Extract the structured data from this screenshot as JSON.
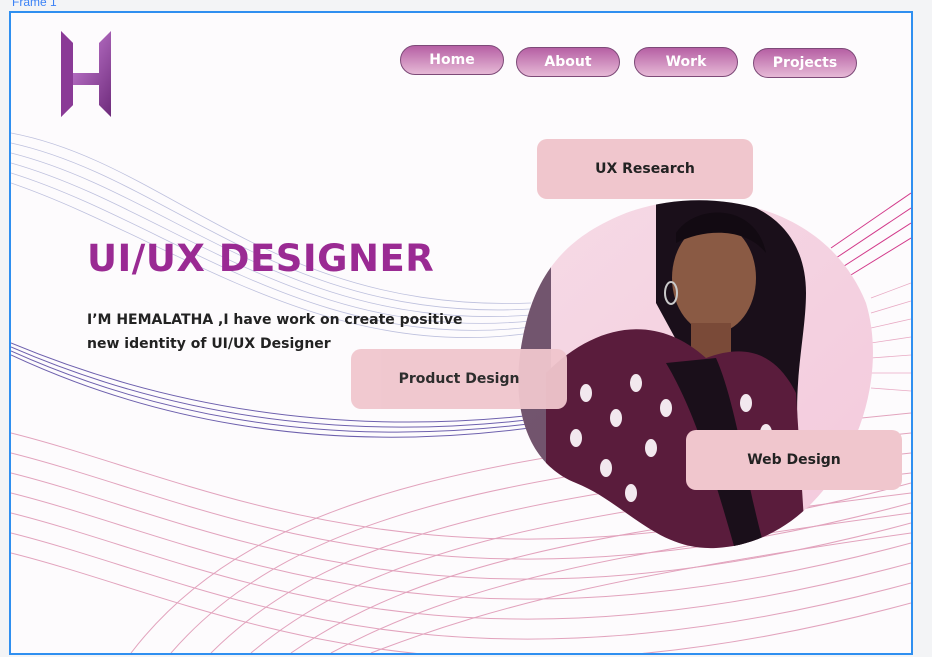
{
  "frame": {
    "label": "Frame 1"
  },
  "nav": {
    "items": [
      "Home",
      "About",
      "Work",
      "Projects"
    ]
  },
  "hero": {
    "title": "UI/UX DESIGNER",
    "description": "I’M HEMALATHA ,I have work on create positive new identity of UI/UX Designer"
  },
  "tags": {
    "ux_research": "UX Research",
    "product_design": "Product Design",
    "web_design": "Web Design"
  },
  "colors": {
    "accent": "#9a2a93",
    "tag_bg": "#f0c6cd",
    "frame_border": "#2f8ff0"
  },
  "icons": {
    "logo": "h-letter-logo"
  }
}
